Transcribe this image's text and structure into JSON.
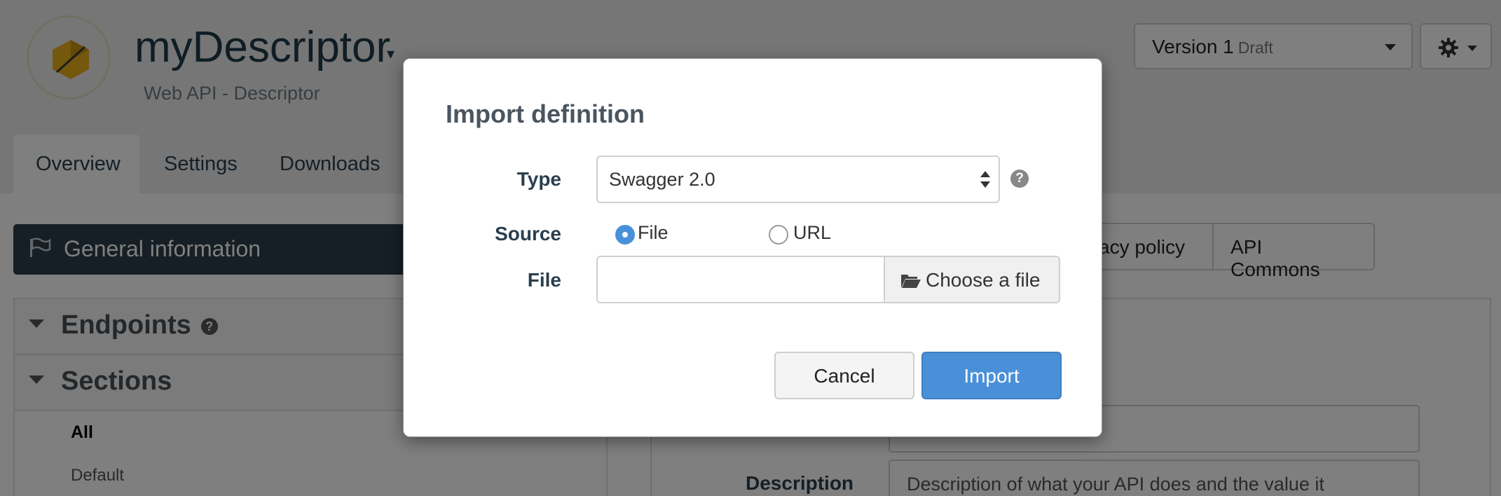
{
  "app": {
    "title": "myDescriptor",
    "subtitle": "Web API - Descriptor",
    "version_label": "Version 1",
    "version_status": "Draft"
  },
  "tabs": [
    {
      "label": "Overview",
      "active": true
    },
    {
      "label": "Settings",
      "active": false
    },
    {
      "label": "Downloads",
      "active": false
    }
  ],
  "sidebar": {
    "general_info": "General information",
    "endpoints": "Endpoints",
    "sections": "Sections",
    "section_items": [
      "All",
      "Default"
    ]
  },
  "right_buttons": {
    "privacy_policy_partial": "vacy policy",
    "api_commons": "API Commons"
  },
  "description": {
    "label": "Description",
    "value_partial": "Description of what your API does and the value it"
  },
  "modal": {
    "title": "Import definition",
    "type_label": "Type",
    "type_value": "Swagger 2.0",
    "source_label": "Source",
    "source_options": [
      {
        "label": "File",
        "checked": true
      },
      {
        "label": "URL",
        "checked": false
      }
    ],
    "file_label": "File",
    "file_value": "",
    "choose_file_label": "Choose a file",
    "cancel_label": "Cancel",
    "import_label": "Import"
  },
  "colors": {
    "primary": "#4a90d9",
    "header_dark": "#2a3e4b",
    "logo_gold": "#e6b01a"
  },
  "icons": [
    "hexagon-logo-icon",
    "gear-icon",
    "flag-icon",
    "help-icon",
    "folder-open-icon"
  ]
}
